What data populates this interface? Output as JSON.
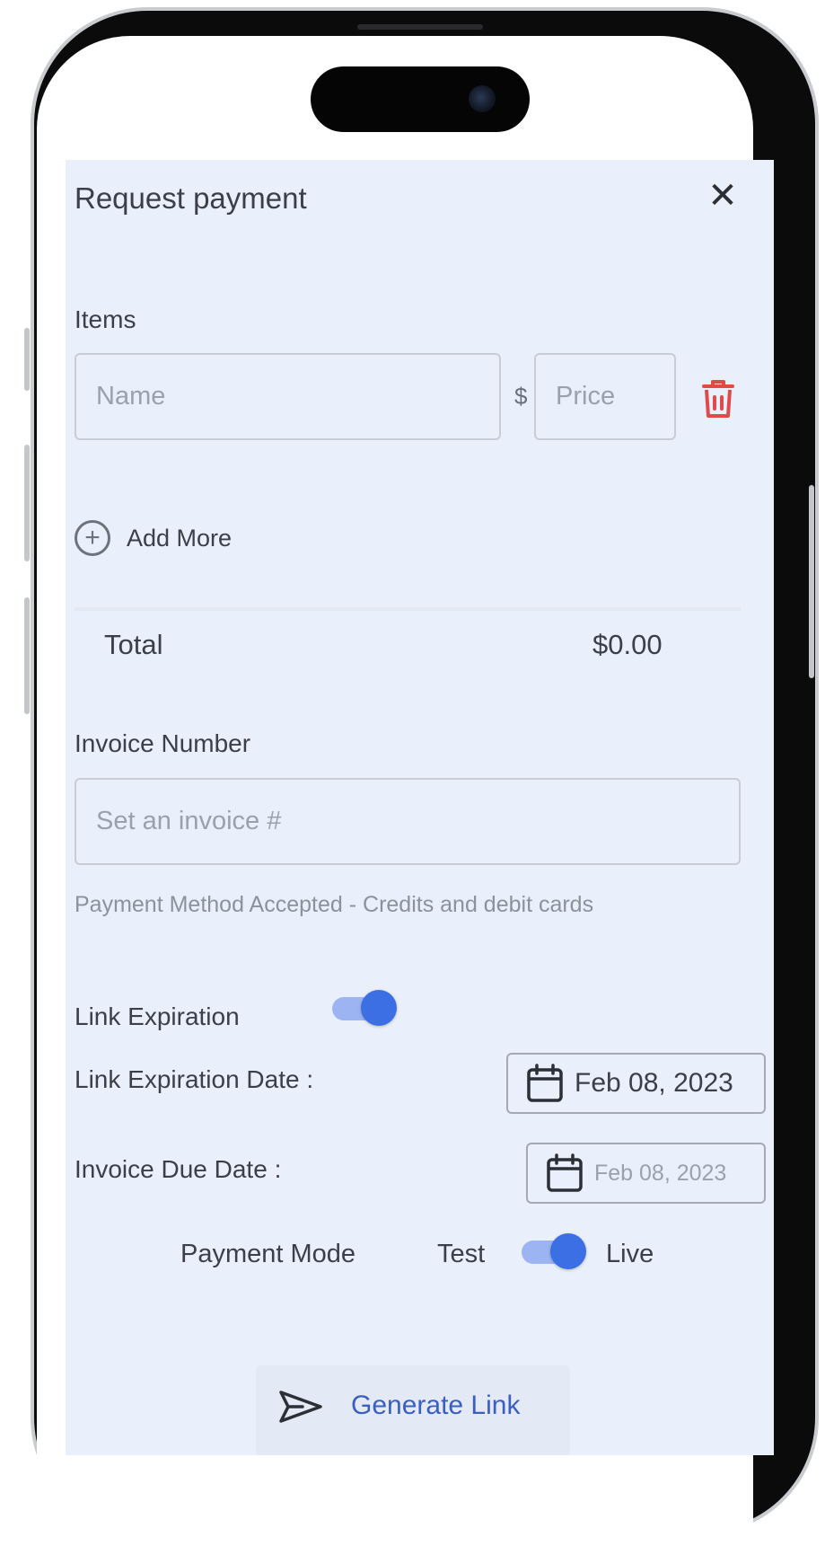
{
  "dialog": {
    "title": "Request payment",
    "close_icon": "close-icon"
  },
  "items": {
    "label": "Items",
    "name_placeholder": "Name",
    "currency": "$",
    "price_placeholder": "Price",
    "delete_icon": "trash-icon"
  },
  "add_more": {
    "label": "Add More",
    "icon": "plus-circle-icon"
  },
  "total": {
    "label": "Total",
    "value": "$0.00"
  },
  "invoice": {
    "label": "Invoice Number",
    "placeholder": "Set an invoice #"
  },
  "payment_method_note": "Payment Method Accepted - Credits and debit cards",
  "link_expiration": {
    "label": "Link Expiration",
    "enabled": true
  },
  "link_expiration_date": {
    "label": "Link Expiration Date :",
    "value": "Feb 08, 2023",
    "icon": "calendar-icon"
  },
  "invoice_due_date": {
    "label": "Invoice Due Date :",
    "value": "Feb 08, 2023",
    "icon": "calendar-icon"
  },
  "payment_mode": {
    "label": "Payment Mode",
    "off_label": "Test",
    "on_label": "Live",
    "is_live": true
  },
  "generate": {
    "label": "Generate Link",
    "icon": "send-icon"
  },
  "colors": {
    "accent": "#3b6fe3",
    "danger": "#e04a4a",
    "background": "#eaf0fb"
  }
}
